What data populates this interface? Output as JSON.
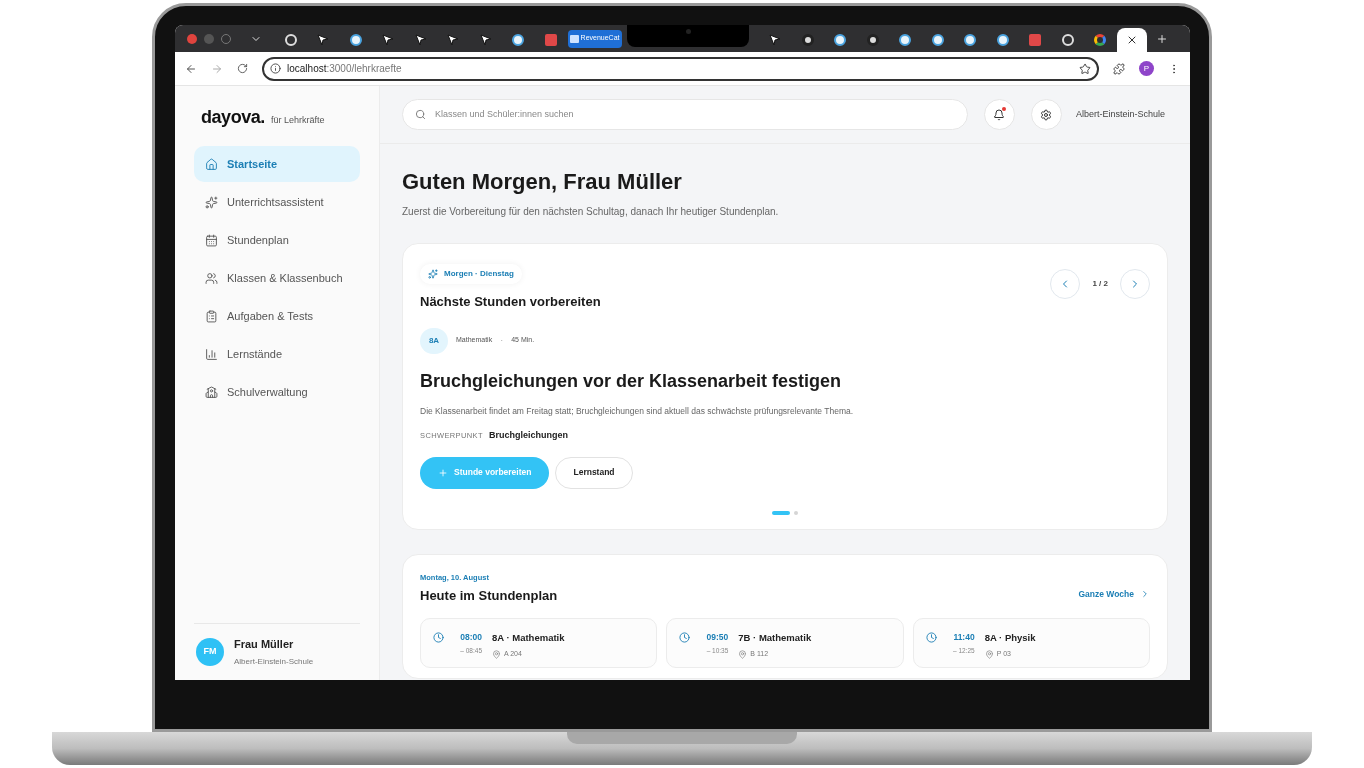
{
  "browser": {
    "tabs": [
      {
        "kind": "ring",
        "selected": false
      },
      {
        "kind": "cursor",
        "selected": false
      },
      {
        "kind": "badge",
        "selected": false
      },
      {
        "kind": "cursor",
        "selected": false
      },
      {
        "kind": "cursor",
        "selected": false
      },
      {
        "kind": "cursor",
        "selected": false
      },
      {
        "kind": "cursor",
        "selected": false
      },
      {
        "kind": "badge",
        "selected": false
      },
      {
        "kind": "square",
        "selected": false
      },
      {
        "kind": "titled",
        "label": "RevenueCat",
        "selected": false
      },
      {
        "kind": "cursor",
        "selected": false
      },
      {
        "kind": "octo",
        "selected": false
      },
      {
        "kind": "badge",
        "selected": false
      },
      {
        "kind": "octo",
        "selected": false
      },
      {
        "kind": "badge",
        "selected": false
      },
      {
        "kind": "badge",
        "selected": false
      },
      {
        "kind": "badge",
        "selected": false
      },
      {
        "kind": "badge",
        "selected": false
      },
      {
        "kind": "square",
        "selected": false
      },
      {
        "kind": "ring",
        "selected": false
      },
      {
        "kind": "g",
        "selected": false
      },
      {
        "kind": "blank",
        "selected": true
      }
    ],
    "url_host": "localhost",
    "url_path": ":3000/lehrkraefte",
    "profile": "P"
  },
  "sidebar": {
    "logo": "dayova.",
    "logo_suffix": "für Lehrkräfte",
    "items": [
      {
        "label": "Startseite",
        "selected": true
      },
      {
        "label": "Unterrichtsassistent",
        "selected": false
      },
      {
        "label": "Stundenplan",
        "selected": false
      },
      {
        "label": "Klassen & Klassenbuch",
        "selected": false
      },
      {
        "label": "Aufgaben & Tests",
        "selected": false
      },
      {
        "label": "Lernstände",
        "selected": false
      },
      {
        "label": "Schulverwaltung",
        "selected": false
      }
    ],
    "user": {
      "initials": "FM",
      "name": "Frau Müller",
      "school": "Albert-Einstein-Schule"
    }
  },
  "header": {
    "search_placeholder": "Klassen und Schüler:innen suchen",
    "notification": true,
    "school": "Albert-Einstein-Schule"
  },
  "greeting": {
    "title": "Guten Morgen, Frau Müller",
    "subtitle": "Zuerst die Vorbereitung für den nächsten Schultag, danach Ihr heutiger Stundenplan."
  },
  "prep_card": {
    "chip": "Morgen · Dienstag",
    "title": "Nächste Stunden vorbereiten",
    "pager": "1 / 2",
    "class": "8A",
    "subject": "Mathematik",
    "separator": "·",
    "duration": "45 Min.",
    "lesson_title": "Bruchgleichungen vor der Klassenarbeit festigen",
    "description": "Die Klassenarbeit findet am Freitag statt; Bruchgleichungen sind aktuell das schwächste prüfungsrelevante Thema.",
    "focus_label": "SCHWERPUNKT",
    "focus": "Bruchgleichungen",
    "primary_button": "Stunde vorbereiten",
    "secondary_button": "Lernstand",
    "slides": [
      {
        "selected": true
      },
      {
        "selected": false
      }
    ]
  },
  "schedule": {
    "date": "Montag, 10. August",
    "title": "Heute im Stundenplan",
    "link": "Ganze Woche",
    "lessons": [
      {
        "start": "08:00",
        "end": "– 08:45",
        "title": "8A · Mathematik",
        "room": "A 204"
      },
      {
        "start": "09:50",
        "end": "– 10:35",
        "title": "7B · Mathematik",
        "room": "B 112"
      },
      {
        "start": "11:40",
        "end": "– 12:25",
        "title": "8A · Physik",
        "room": "P 03"
      }
    ]
  }
}
